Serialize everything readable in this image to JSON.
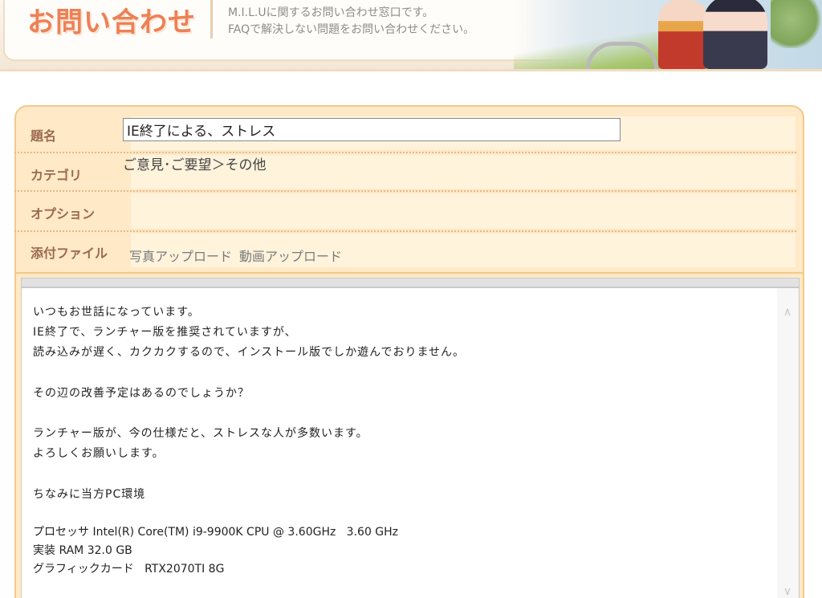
{
  "header": {
    "title": "お問い合わせ",
    "description_line1": "M.I.L.Uに関するお問い合わせ窓口です。",
    "description_line2": "FAQで解決しない問題をお問い合わせください。"
  },
  "form": {
    "title_label": "題名",
    "title_value": "IE終了による、ストレス",
    "category_label": "カテゴリ",
    "category_value": "ご意見･ご要望＞その他",
    "option_label": "オプション",
    "attachment_label": "添付ファイル",
    "photo_upload": "写真アップロード",
    "video_upload": "動画アップロード"
  },
  "message": {
    "lines": [
      "いつもお世話になっています。",
      "IE終了で、ランチャー版を推奨されていますが、",
      "読み込みが遅く、カクカクするので、インストール版でしか遊んでおりません。",
      "",
      "その辺の改善予定はあるのでしょうか？",
      "",
      "ランチャー版が、今の仕様だと、ストレスな人が多数います。",
      "よろしくお願いします。",
      "",
      "ちなみに当方PC環境",
      "",
      "プロセッサ Intel(R) Core(TM) i9-9900K CPU @ 3.60GHz   3.60 GHz",
      "実装 RAM 32.0 GB",
      "グラフィックカード   RTX2070TI 8G"
    ]
  },
  "scrollbar": {
    "up_icon": "chevron-up-icon",
    "down_icon": "chevron-down-icon"
  },
  "colors": {
    "accent": "#ec8156",
    "panel_bg": "#ffe9c6",
    "panel_border": "#f3c98b",
    "label_text": "#9a6a4f"
  }
}
